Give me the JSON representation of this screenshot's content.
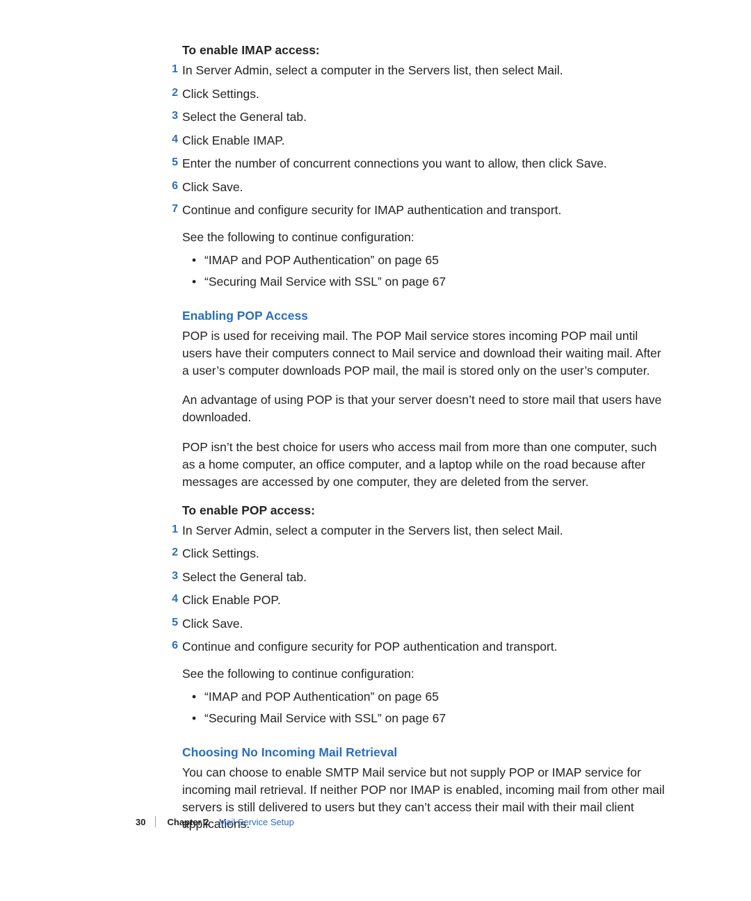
{
  "imap": {
    "heading": "To enable IMAP access:",
    "steps": [
      "In Server Admin, select a computer in the Servers list, then select Mail.",
      "Click Settings.",
      "Select the General tab.",
      "Click Enable IMAP.",
      "Enter the number of concurrent connections you want to allow, then click Save.",
      "Click Save.",
      "Continue and configure security for IMAP authentication and transport."
    ],
    "continue": "See the following to continue configuration:",
    "bullets": [
      "“IMAP and POP Authentication” on page 65",
      "“Securing Mail Service with SSL” on page 67"
    ]
  },
  "pop_section": {
    "heading": "Enabling POP Access",
    "p1": "POP is used for receiving mail. The POP Mail service stores incoming POP mail until users have their computers connect to Mail service and download their waiting mail. After a user’s computer downloads POP mail, the mail is stored only on the user’s computer.",
    "p2": "An advantage of using POP is that your server doesn’t need to store mail that users have downloaded.",
    "p3": "POP isn’t the best choice for users who access mail from more than one computer, such as a home computer, an office computer, and a laptop while on the road because after messages are accessed by one computer, they are deleted from the server."
  },
  "pop": {
    "heading": "To enable POP access:",
    "steps": [
      "In Server Admin, select a computer in the Servers list, then select Mail.",
      "Click Settings.",
      "Select the General tab.",
      "Click Enable POP.",
      "Click Save.",
      "Continue and configure security for POP authentication and transport."
    ],
    "continue": "See the following to continue configuration:",
    "bullets": [
      "“IMAP and POP Authentication” on page 65",
      "“Securing Mail Service with SSL” on page 67"
    ]
  },
  "no_incoming": {
    "heading": "Choosing No Incoming Mail Retrieval",
    "p1": "You can choose to enable SMTP Mail service but not supply POP or IMAP service for incoming mail retrieval. If neither POP nor IMAP is enabled, incoming mail from other mail servers is still delivered to users but they can’t access their mail with their mail client applications."
  },
  "footer": {
    "page": "30",
    "chapter": "Chapter 2",
    "title": "Mail Service Setup"
  }
}
